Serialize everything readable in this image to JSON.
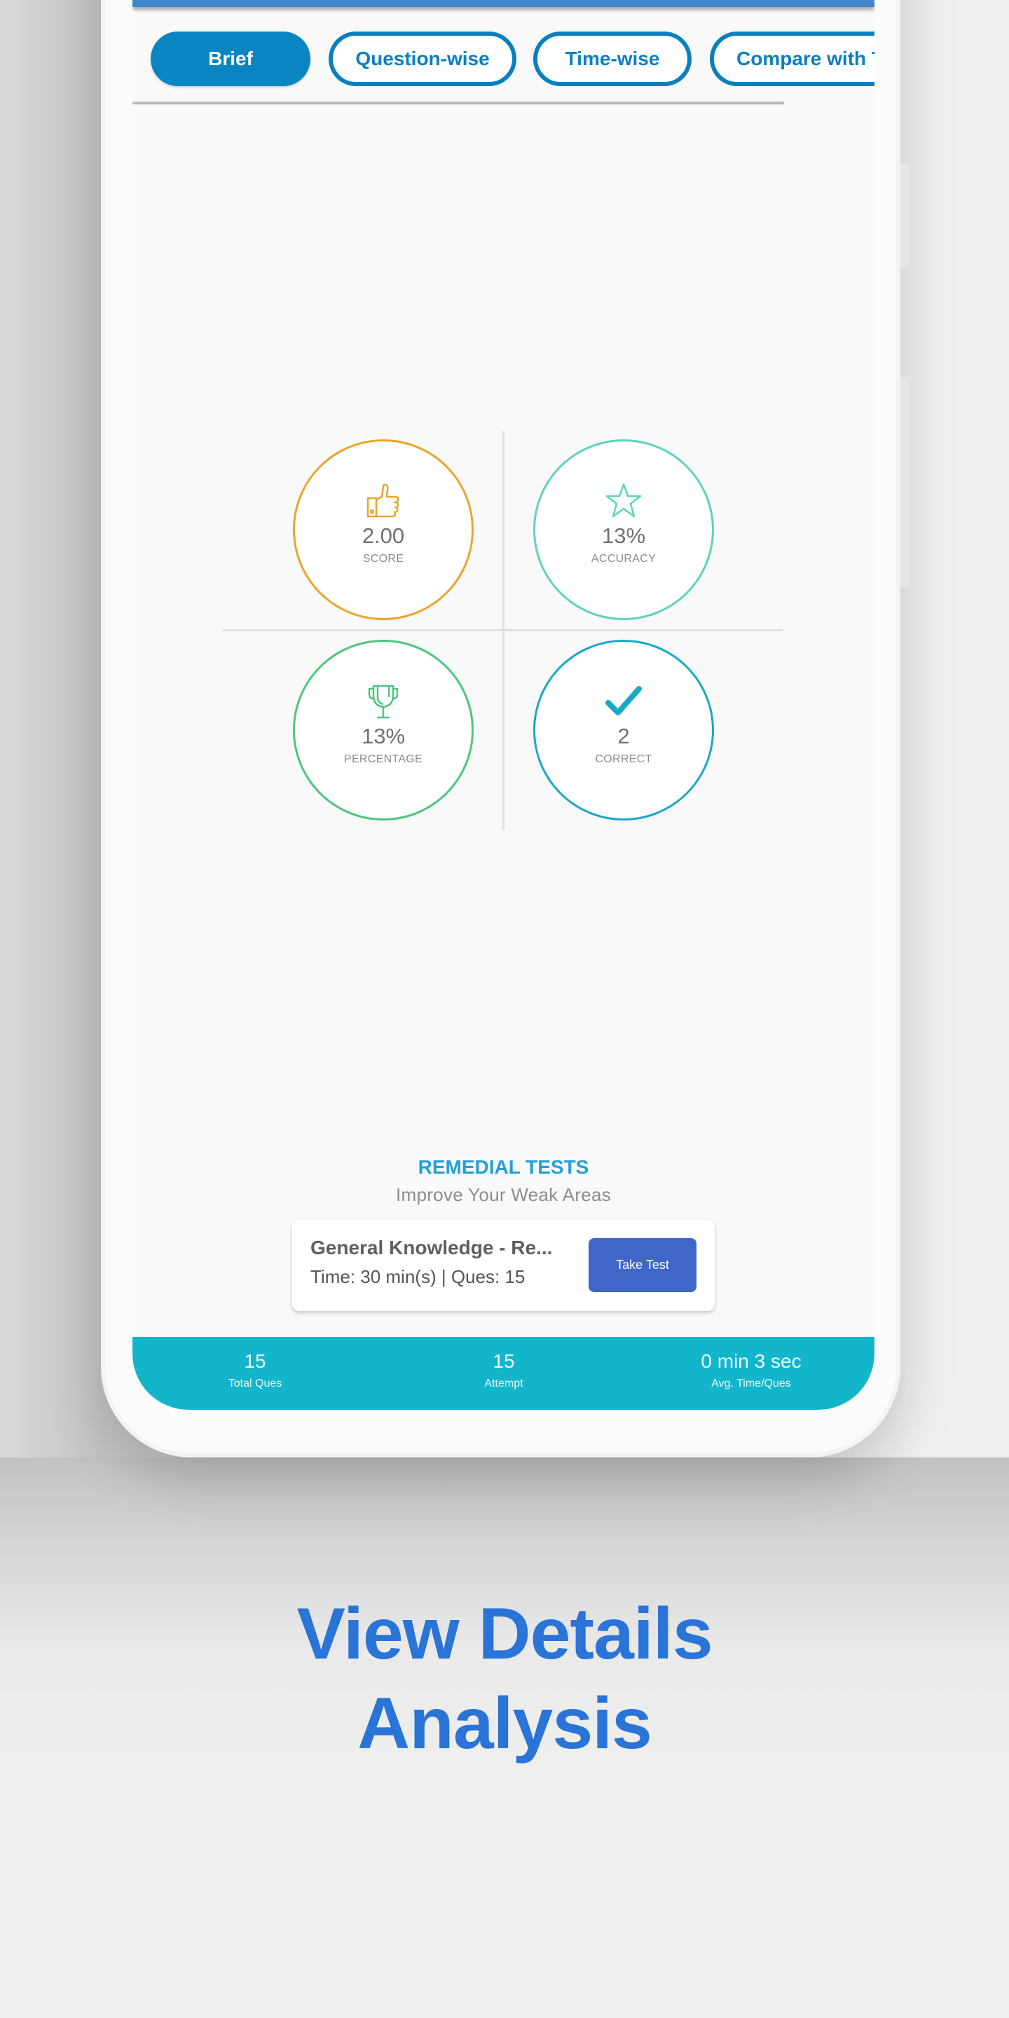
{
  "tabs": [
    {
      "label": "Brief",
      "active": true
    },
    {
      "label": "Question-wise",
      "active": false
    },
    {
      "label": "Time-wise",
      "active": false
    },
    {
      "label": "Compare with T",
      "active": false
    }
  ],
  "stats": [
    {
      "icon": "thumbs-up-icon",
      "value": "2.00",
      "label": "SCORE",
      "color": "#e9a52b"
    },
    {
      "icon": "star-icon",
      "value": "13%",
      "label": "ACCURACY",
      "color": "#5fd3bd"
    },
    {
      "icon": "trophy-icon",
      "value": "13%",
      "label": "PERCENTAGE",
      "color": "#4cc67e"
    },
    {
      "icon": "checkmark-icon",
      "value": "2",
      "label": "CORRECT",
      "color": "#19a8c8"
    }
  ],
  "remedial": {
    "title": "REMEDIAL TESTS",
    "subtitle": "Improve Your Weak Areas",
    "card": {
      "title": "General Knowledge - Re...",
      "meta": "Time: 30 min(s) | Ques: 15",
      "button": "Take Test"
    }
  },
  "summary": [
    {
      "value": "15",
      "caption": "Total Ques"
    },
    {
      "value": "15",
      "caption": "Attempt"
    },
    {
      "value": "0 min 3 sec",
      "caption": "Avg. Time/Ques"
    }
  ],
  "headline": {
    "line1": "View Details",
    "line2": "Analysis"
  },
  "colors": {
    "tab_accent": "#0a7fc0",
    "remedial_title": "#23a0d8",
    "take_test_button": "#3f66c8",
    "summary_bar": "#13b5cb",
    "headline": "#2a74d8"
  }
}
